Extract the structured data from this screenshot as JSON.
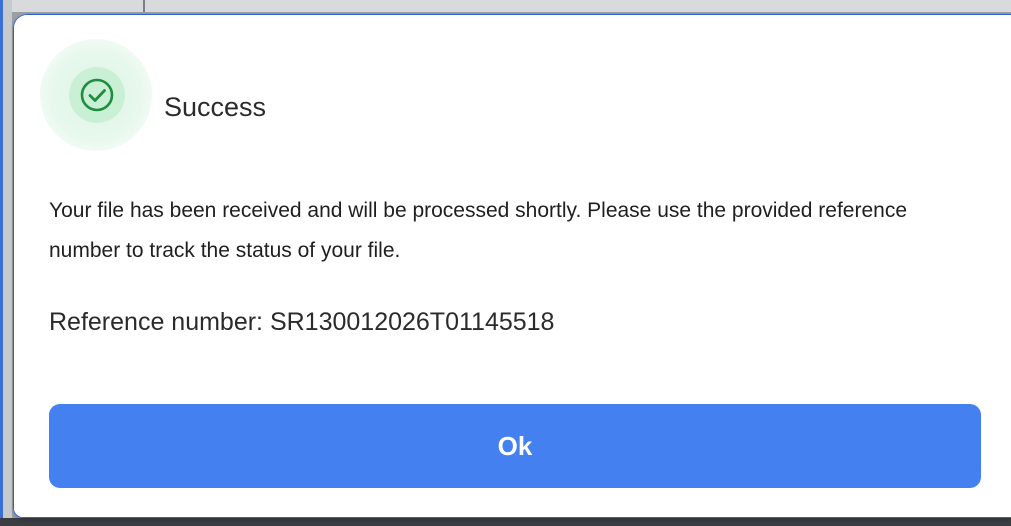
{
  "dialog": {
    "icon": "check-circle-icon",
    "title": "Success",
    "message": "Your file has been received and will be processed shortly. Please use the provided reference number to track the status of your file.",
    "reference": "Reference number: SR130012026T01145518",
    "ok_label": "Ok"
  },
  "colors": {
    "accent": "#4480f0",
    "success": "#1e8e3e",
    "success_bg": "#c9efd5"
  }
}
